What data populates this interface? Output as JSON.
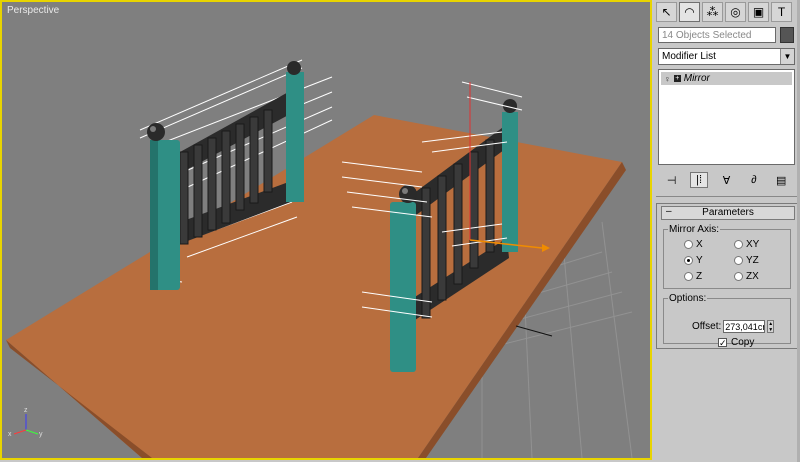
{
  "viewport": {
    "label": "Perspective"
  },
  "command_panel": {
    "tabs": [
      {
        "name": "create-tab-icon",
        "glyph": "↖"
      },
      {
        "name": "modify-tab-icon",
        "glyph": "◠"
      },
      {
        "name": "hierarchy-tab-icon",
        "glyph": "⁂"
      },
      {
        "name": "motion-tab-icon",
        "glyph": "◎"
      },
      {
        "name": "display-tab-icon",
        "glyph": "▣"
      },
      {
        "name": "utilities-tab-icon",
        "glyph": "T"
      }
    ],
    "selection": "14 Objects Selected",
    "modifier_list": "Modifier List",
    "stack_items": [
      {
        "label": "Mirror"
      }
    ],
    "stack_tools": [
      {
        "name": "pin-stack-icon",
        "glyph": "⊣"
      },
      {
        "name": "show-end-result-icon",
        "glyph": "|⁞"
      },
      {
        "name": "make-unique-icon",
        "glyph": "∀"
      },
      {
        "name": "remove-modifier-icon",
        "glyph": "∂"
      },
      {
        "name": "configure-sets-icon",
        "glyph": "▤"
      }
    ],
    "parameters": {
      "title": "Parameters",
      "collapse": "–",
      "mirror_axis": {
        "title": "Mirror Axis:",
        "options": [
          "X",
          "Y",
          "Z",
          "XY",
          "YZ",
          "ZX"
        ],
        "selected": "Y"
      },
      "options": {
        "title": "Options:",
        "offset_label": "Offset:",
        "offset_value": "273,041cm",
        "copy_label": "Copy",
        "copy_checked": true
      }
    }
  }
}
